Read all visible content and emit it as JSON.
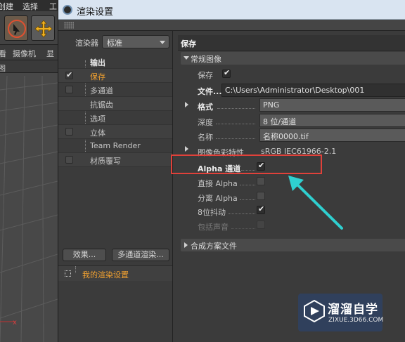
{
  "background_app": {
    "menu": [
      "创建",
      "选择",
      "工"
    ],
    "tabs": [
      "看",
      "摄像机",
      "显"
    ],
    "viewport_tab": "图"
  },
  "dialog": {
    "title": "渲染设置"
  },
  "left_panel": {
    "renderer_label": "渲染器",
    "renderer_value": "标准",
    "items": [
      {
        "label": "输出",
        "checkbox": "none",
        "active": false,
        "bold": true
      },
      {
        "label": "保存",
        "checkbox": "checked",
        "active": true,
        "bold": false
      },
      {
        "label": "多通道",
        "checkbox": "unchecked",
        "active": false,
        "bold": false
      },
      {
        "label": "抗锯齿",
        "checkbox": "none",
        "active": false,
        "bold": false
      },
      {
        "label": "选项",
        "checkbox": "none",
        "active": false,
        "bold": false
      },
      {
        "label": "立体",
        "checkbox": "unchecked",
        "active": false,
        "bold": false
      },
      {
        "label": "Team Render",
        "checkbox": "none",
        "active": false,
        "bold": false
      },
      {
        "label": "材质覆写",
        "checkbox": "unchecked",
        "active": false,
        "bold": false
      }
    ],
    "effects_button": "效果...",
    "multipass_button": "多通道渲染...",
    "preset_label": "我的渲染设置"
  },
  "right_panel": {
    "header": "保存",
    "section_general": "常规图像",
    "save_label": "保存",
    "file_label": "文件...",
    "file_value": "C:\\Users\\Administrator\\Desktop\\001",
    "format_label": "格式",
    "format_value": "PNG",
    "depth_label": "深度",
    "depth_value": "8 位/通道",
    "name_label": "名称",
    "name_value": "名称0000.tif",
    "color_profile_label": "图像色彩特性",
    "color_profile_value": "sRGB IEC61966-2.1",
    "alpha_label": "Alpha 通道",
    "straight_alpha_label": "直接 Alpha",
    "separate_alpha_label": "分离 Alpha",
    "dither_label": "8位抖动",
    "include_sound_label": "包括声音",
    "section_composite": "合成方案文件"
  },
  "watermark": {
    "title": "溜溜自学",
    "url": "ZIXUE.3D66.COM"
  },
  "colors": {
    "active_orange": "#f0a030",
    "highlight_red": "#e0413a",
    "arrow_cyan": "#2fd0d0"
  }
}
